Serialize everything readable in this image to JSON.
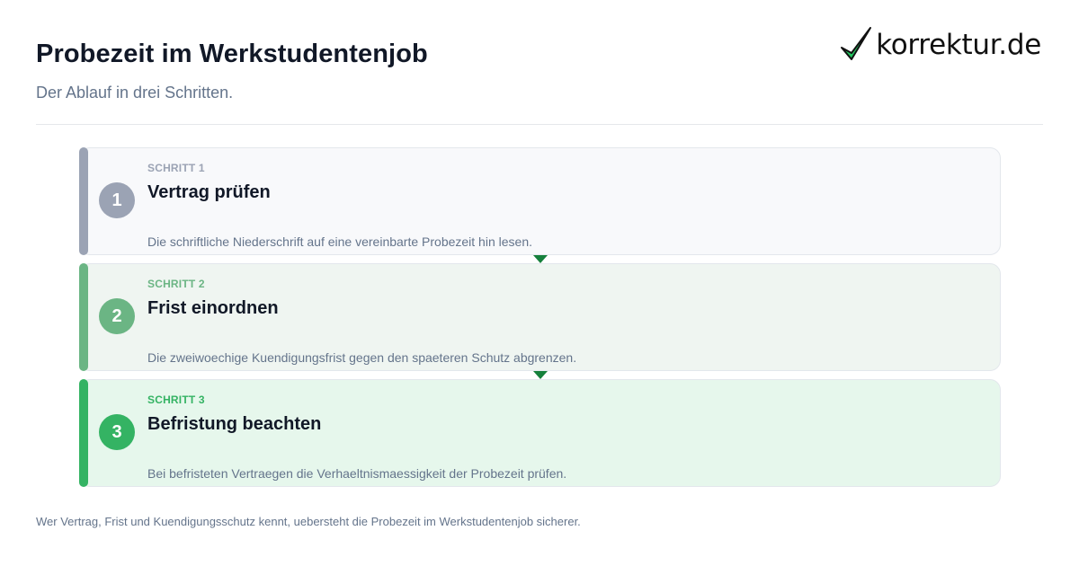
{
  "header": {
    "title": "Probezeit im Werkstudentenjob",
    "subtitle": "Der Ablauf in drei Schritten."
  },
  "brand": {
    "name": "korrektur.de",
    "icon": "checkmark-icon",
    "check_color": "#22c55e"
  },
  "steps": [
    {
      "number": "1",
      "kicker": "SCHRITT 1",
      "title": "Vertrag prüfen",
      "description": "Die schriftliche Niederschrift auf eine vereinbarte Probezeit hin lesen.",
      "color": "#9ba3b4",
      "background": "#f8f9fb"
    },
    {
      "number": "2",
      "kicker": "SCHRITT 2",
      "title": "Frist einordnen",
      "description": "Die zweiwoechige Kuendigungsfrist gegen den spaeteren Schutz abgrenzen.",
      "color": "#6bb584",
      "background": "#eff5f1"
    },
    {
      "number": "3",
      "kicker": "SCHRITT 3",
      "title": "Befristung beachten",
      "description": "Bei befristeten Vertraegen die Verhaeltnismaessigkeit der Probezeit prüfen.",
      "color": "#34b363",
      "background": "#e6f7ec"
    }
  ],
  "connector_color": "#16803c",
  "footer": {
    "text": "Wer Vertrag, Frist und Kuendigungsschutz kennt, uebersteht die Probezeit im Werkstudentenjob sicherer."
  }
}
